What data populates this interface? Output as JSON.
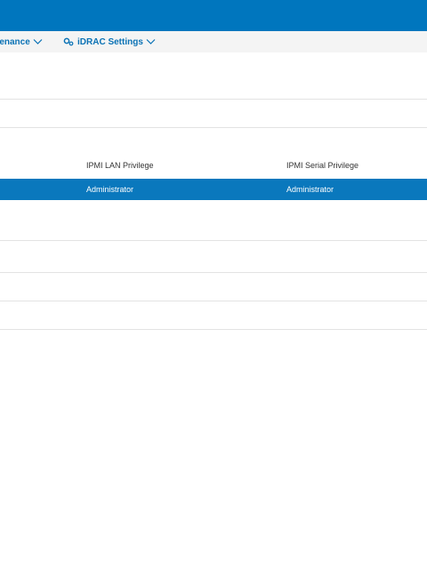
{
  "nav": {
    "maintenance_label": "tenance",
    "idrac_settings_label": "iDRAC Settings"
  },
  "table": {
    "columns": [
      "IPMI LAN Privilege",
      "IPMI Serial Privilege"
    ],
    "rows": [
      {
        "ipmi_lan_privilege": "Administrator",
        "ipmi_serial_privilege": "Administrator",
        "selected": true
      }
    ]
  },
  "colors": {
    "header_blue": "#0076be",
    "selected_row": "#0a78bd",
    "menu_text": "#0a72b5"
  }
}
